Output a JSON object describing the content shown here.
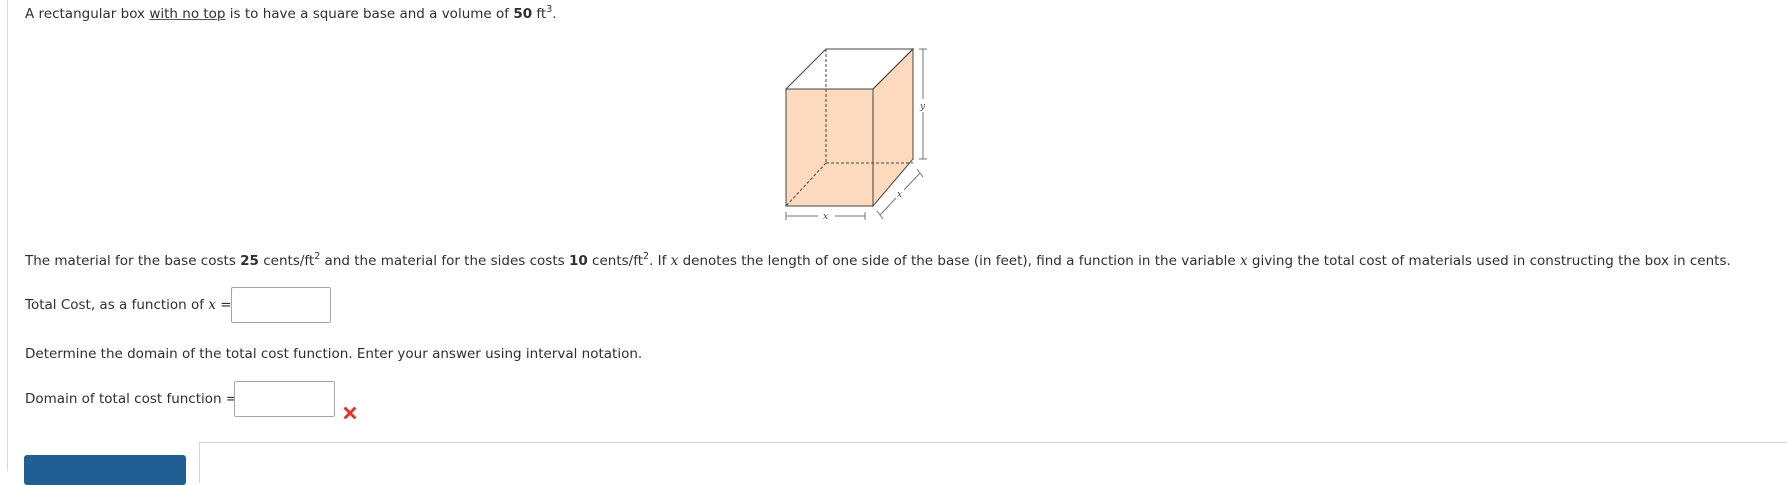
{
  "problem": {
    "intro_pre": "A rectangular box ",
    "intro_link": "with no top",
    "intro_mid": " is to have a square base and a volume of ",
    "volume_value": "50",
    "unit_ft": "ft",
    "exp3": "3",
    "period": ".",
    "material_pre": "The material for the base costs ",
    "base_cost": "25",
    "cents_ft": "cents/ft",
    "exp2": "2",
    "material_mid": " and the material for the sides costs ",
    "side_cost": "10",
    "material_if": ". If ",
    "var_x": "x",
    "material_post": " denotes the length of one side of the base (in feet), find a function in the variable ",
    "material_end": " giving the total cost of materials used in constructing the box in cents.",
    "domain_prompt": "Determine the domain of the total cost function. Enter your answer using interval notation."
  },
  "answers": {
    "cost_label_pre": "Total Cost, as a function of ",
    "cost_label_post": " =",
    "domain_label": "Domain of total cost function =",
    "cost_value": "",
    "domain_value": "",
    "domain_status": "incorrect"
  },
  "figure": {
    "label_x_front": "x",
    "label_x_side": "x",
    "label_y": "y",
    "fill_color": "#fdd9bd"
  },
  "colors": {
    "submit_button": "#1f5f94",
    "error_mark": "#e0352b"
  }
}
